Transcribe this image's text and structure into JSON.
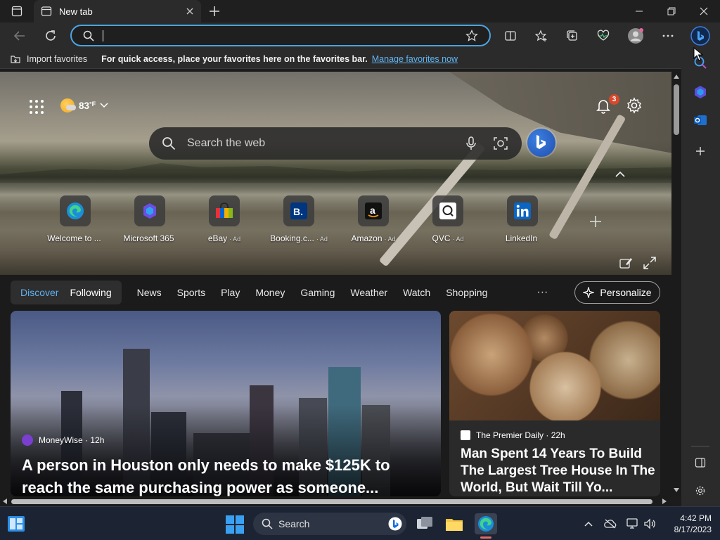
{
  "tab": {
    "title": "New tab"
  },
  "address": {
    "value": "",
    "placeholder": ""
  },
  "favorites_bar": {
    "import_label": "Import favorites",
    "hint": "For quick access, place your favorites here on the favorites bar.",
    "manage_link": "Manage favorites now"
  },
  "weather": {
    "temp": "83",
    "unit": "°F"
  },
  "notifications": {
    "count": "3"
  },
  "web_search": {
    "placeholder": "Search the web"
  },
  "quick_links": [
    {
      "label": "Welcome to ...",
      "ad": ""
    },
    {
      "label": "Microsoft 365",
      "ad": ""
    },
    {
      "label": "eBay",
      "ad": "· Ad"
    },
    {
      "label": "Booking.c...",
      "ad": "· Ad"
    },
    {
      "label": "Amazon",
      "ad": "· Ad"
    },
    {
      "label": "QVC",
      "ad": "· Ad"
    },
    {
      "label": "LinkedIn",
      "ad": ""
    }
  ],
  "feed_nav": {
    "discover": "Discover",
    "following": "Following",
    "links": [
      "News",
      "Sports",
      "Play",
      "Money",
      "Gaming",
      "Weather",
      "Watch",
      "Shopping"
    ],
    "more": "···",
    "personalize": "Personalize"
  },
  "cards": {
    "main": {
      "source": "MoneyWise · 12h",
      "headline": "A person in Houston only needs to make $125K to reach the same purchasing power as someone..."
    },
    "side": {
      "source": "The Premier Daily · 22h",
      "headline": "Man Spent 14 Years To Build The Largest Tree House In The World, But Wait Till Yo..."
    }
  },
  "taskbar": {
    "search_label": "Search",
    "time": "4:42 PM",
    "date": "8/17/2023"
  },
  "colors": {
    "accent": "#4ca3e0",
    "link": "#60b4f0",
    "discover": "#5fb1f0",
    "badge": "#d9482b"
  }
}
